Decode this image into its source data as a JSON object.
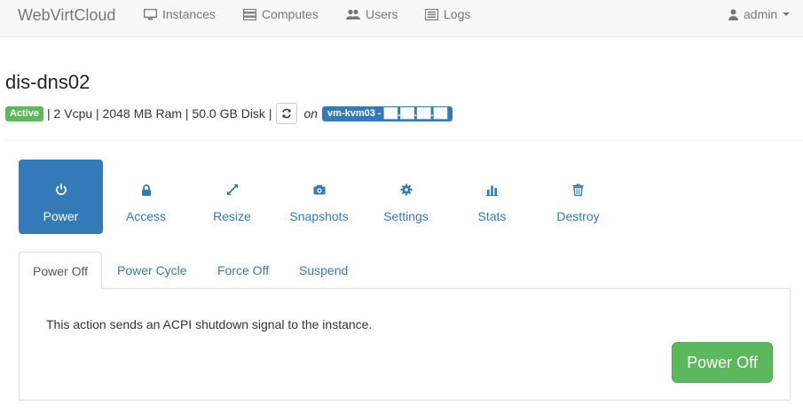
{
  "navbar": {
    "brand": "WebVirtCloud",
    "items": [
      {
        "label": "Instances",
        "icon": "monitor-icon"
      },
      {
        "label": "Computes",
        "icon": "server-icon"
      },
      {
        "label": "Users",
        "icon": "users-icon"
      },
      {
        "label": "Logs",
        "icon": "list-icon"
      }
    ],
    "user": {
      "label": "admin",
      "icon": "user-icon"
    }
  },
  "instance": {
    "name": "dis-dns02",
    "status": "Active",
    "specs": "| 2 Vcpu | 2048 MB Ram | 50.0 GB Disk |",
    "on_text": "on",
    "host": "vm-kvm03 - ██.██.██.██"
  },
  "actions": [
    {
      "label": "Power",
      "icon": "power-icon",
      "active": true
    },
    {
      "label": "Access",
      "icon": "lock-icon"
    },
    {
      "label": "Resize",
      "icon": "resize-icon"
    },
    {
      "label": "Snapshots",
      "icon": "camera-icon"
    },
    {
      "label": "Settings",
      "icon": "gear-icon"
    },
    {
      "label": "Stats",
      "icon": "bar-chart-icon"
    },
    {
      "label": "Destroy",
      "icon": "trash-icon"
    }
  ],
  "power_tabs": [
    {
      "label": "Power Off",
      "active": true
    },
    {
      "label": "Power Cycle"
    },
    {
      "label": "Force Off"
    },
    {
      "label": "Suspend"
    }
  ],
  "panel": {
    "description": "This action sends an ACPI shutdown signal to the instance.",
    "button_label": "Power Off"
  },
  "colors": {
    "primary": "#337ab7",
    "success": "#5cb85c",
    "navbar_bg": "#f8f8f8",
    "nav_text": "#777777"
  }
}
